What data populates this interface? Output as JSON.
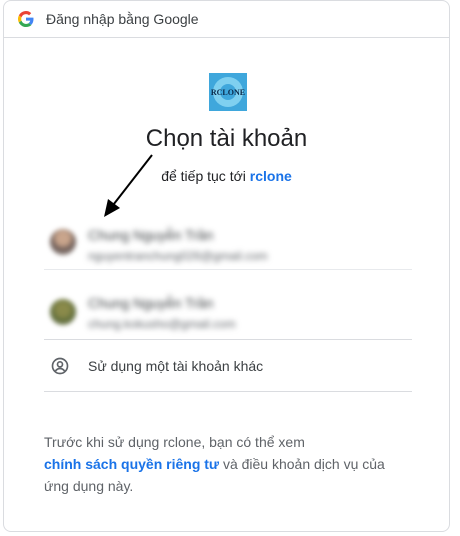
{
  "header": {
    "title": "Đăng nhập bằng Google",
    "logo_icon": "google-g-icon"
  },
  "app": {
    "logo_text": "RCLONE",
    "logo_icon": "rclone-logo-icon"
  },
  "main": {
    "title": "Chọn tài khoản",
    "subtitle_prefix": "để tiếp tục tới",
    "app_name": "rclone"
  },
  "accounts": [
    {
      "name": "Chung Nguyễn Trần",
      "email": "nguyentranchung026@gmail.com"
    },
    {
      "name": "Chung Nguyễn Trần",
      "email": "chung.kokusho@gmail.com"
    }
  ],
  "other_account": {
    "label": "Sử dụng một tài khoản khác",
    "icon": "account-circle-icon"
  },
  "policy": {
    "part1": "Trước khi sử dụng rclone, bạn có thể xem",
    "link": "chính sách quyền riêng tư",
    "part2": "và điều khoản dịch vụ của",
    "part3": "ứng dụng này."
  },
  "colors": {
    "link": "#1a73e8",
    "border": "#dadce0",
    "text": "#202124",
    "muted": "#5f6368"
  }
}
